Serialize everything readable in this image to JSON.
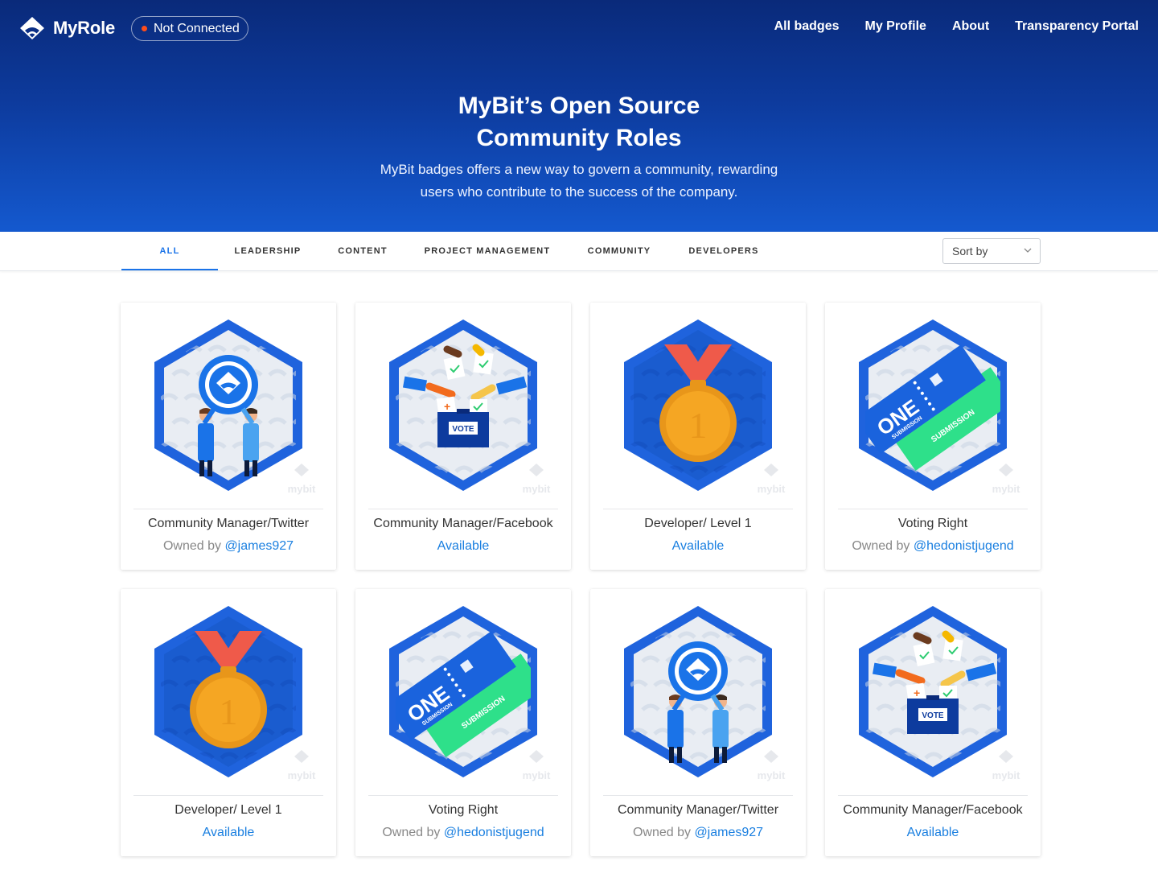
{
  "app": {
    "name": "MyRole",
    "connection_status": "Not Connected"
  },
  "nav": {
    "items": [
      "All badges",
      "My Profile",
      "About",
      "Transparency Portal"
    ]
  },
  "hero": {
    "title_line1": "MyBit’s Open Source",
    "title_line2": "Community Roles",
    "subtitle_line1": "MyBit badges offers a new way to govern a community, rewarding",
    "subtitle_line2": "users who contribute to the success of the company."
  },
  "tabs": {
    "items": [
      "ALL",
      "LEADERSHIP",
      "CONTENT",
      "PROJECT MANAGEMENT",
      "COMMUNITY",
      "DEVELOPERS"
    ],
    "active": "ALL"
  },
  "sort": {
    "label": "Sort by"
  },
  "badge_watermark": "mybit",
  "cards": [
    {
      "title": "Community Manager/Twitter",
      "owned_prefix": "Owned by",
      "owner": "@james927",
      "status": "",
      "art": "community-manager-art"
    },
    {
      "title": "Community Manager/Facebook",
      "owned_prefix": "",
      "owner": "",
      "status": "Available",
      "art": "vote-art"
    },
    {
      "title": "Developer/ Level 1",
      "owned_prefix": "",
      "owner": "",
      "status": "Available",
      "art": "medal-art"
    },
    {
      "title": "Voting Right",
      "owned_prefix": "Owned by",
      "owner": "@hedonistjugend",
      "status": "",
      "art": "ticket-art"
    },
    {
      "title": "Developer/ Level 1",
      "owned_prefix": "",
      "owner": "",
      "status": "Available",
      "art": "medal-art"
    },
    {
      "title": "Voting Right",
      "owned_prefix": "Owned by",
      "owner": "@hedonistjugend",
      "status": "",
      "art": "ticket-art"
    },
    {
      "title": "Community Manager/Twitter",
      "owned_prefix": "Owned by",
      "owner": "@james927",
      "status": "",
      "art": "community-manager-art"
    },
    {
      "title": "Community Manager/Facebook",
      "owned_prefix": "",
      "owner": "",
      "status": "Available",
      "art": "vote-art"
    }
  ],
  "art_text": {
    "vote_label": "VOTE",
    "ticket_big": "ONE",
    "ticket_small": "SUBMISSION",
    "medal_number": "1"
  },
  "colors": {
    "hex_outer": "#1f63dd",
    "hex_inner": "#e9edf3",
    "accent_blue": "#1a73e8",
    "link_blue": "#1a7fe0",
    "medal_gold": "#f5a623",
    "ribbon_red": "#ef5a4a",
    "ticket_green": "#2ee08a",
    "status_dot": "#ff4d1a"
  }
}
